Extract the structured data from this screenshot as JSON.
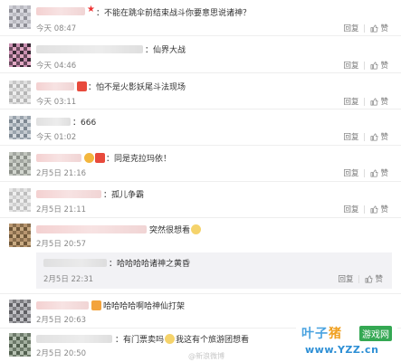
{
  "labels": {
    "reply": "回复",
    "like": "赞"
  },
  "comments": [
    {
      "text": "：不能在跳伞前结束战斗你要意思说诸神？",
      "time": "今天 08:47"
    },
    {
      "text": "：仙界大战",
      "time": "今天 04:46"
    },
    {
      "text": "：怕不是火影妖尾斗法现场",
      "time": "今天 03:11"
    },
    {
      "text": "：666",
      "time": "今天 01:02"
    },
    {
      "text": "：同是克拉玛依！",
      "time": "2月5日 21:16"
    },
    {
      "text": "：孤儿争霸",
      "time": "2月5日 21:11"
    },
    {
      "text": "突然很想看",
      "time": "2月5日 20:57"
    },
    {
      "text": "哈哈哈哈啊哈神仙打架",
      "time": "2月5日 20:63"
    },
    {
      "text": "：有门票卖吗",
      "text2": "我这有个旅游团想看",
      "time": "2月5日 20:50"
    }
  ],
  "reply": {
    "text": "：哈哈哈哈诸神之黄昏",
    "time": "2月5日 22:31"
  },
  "watermark": {
    "brand_a": "叶子",
    "brand_b": "猪",
    "badge": "游戏网",
    "url": "www.YZZ.cn",
    "sina": "@新浪微博"
  }
}
